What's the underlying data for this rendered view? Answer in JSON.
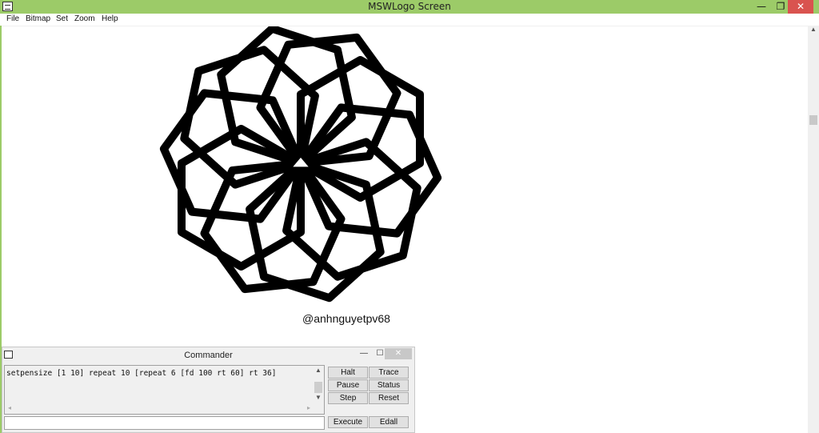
{
  "window": {
    "title": "MSWLogo Screen",
    "min_glyph": "—",
    "max_glyph": "❐",
    "close_glyph": "✕"
  },
  "menu": [
    "File",
    "Bitmap",
    "Set",
    "Zoom",
    "Help"
  ],
  "canvas": {
    "signature": "@anhnguyetpv68",
    "pen_color": "#000000",
    "pen_size": 10,
    "repeat_outer": 10,
    "repeat_inner": 6,
    "forward": 100,
    "turn_inner": 60,
    "turn_outer": 36
  },
  "commander": {
    "title": "Commander",
    "min_glyph": "—",
    "max_glyph": "☐",
    "close_glyph": "✕",
    "history_line": "setpensize [1 10] repeat 10 [repeat 6 [fd 100 rt 60] rt 36]",
    "input_value": "",
    "buttons": {
      "halt": "Halt",
      "trace": "Trace",
      "pause": "Pause",
      "status": "Status",
      "step": "Step",
      "reset": "Reset",
      "execute": "Execute",
      "edall": "Edall"
    }
  },
  "colors": {
    "titlebar": "#9ccb68",
    "close": "#d9534f"
  }
}
